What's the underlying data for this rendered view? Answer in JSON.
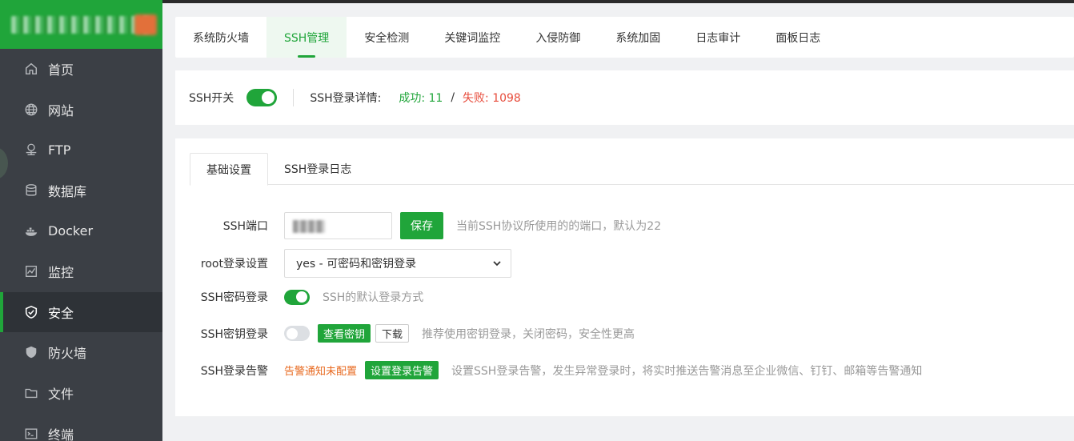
{
  "sidebar": {
    "items": [
      {
        "label": "首页",
        "icon": "home-icon"
      },
      {
        "label": "网站",
        "icon": "globe-icon"
      },
      {
        "label": "FTP",
        "icon": "ftp-icon"
      },
      {
        "label": "数据库",
        "icon": "database-icon"
      },
      {
        "label": "Docker",
        "icon": "docker-icon"
      },
      {
        "label": "监控",
        "icon": "monitor-icon"
      },
      {
        "label": "安全",
        "icon": "shield-check-icon",
        "active": true
      },
      {
        "label": "防火墙",
        "icon": "firewall-shield-icon"
      },
      {
        "label": "文件",
        "icon": "folder-icon"
      },
      {
        "label": "终端",
        "icon": "terminal-icon"
      }
    ]
  },
  "tabs": [
    "系统防火墙",
    "SSH管理",
    "安全检测",
    "关键词监控",
    "入侵防御",
    "系统加固",
    "日志审计",
    "面板日志"
  ],
  "active_tab": "SSH管理",
  "status": {
    "switch_label": "SSH开关",
    "details_label": "SSH登录详情:",
    "success": "成功: 11",
    "separator": "/",
    "fail": "失败: 1098"
  },
  "subtabs": [
    "基础设置",
    "SSH登录日志"
  ],
  "settings": {
    "port_label": "SSH端口",
    "save_label": "保存",
    "port_hint": "当前SSH协议所使用的的端口，默认为22",
    "root_label": "root登录设置",
    "root_value": "yes - 可密码和密钥登录",
    "password_label": "SSH密码登录",
    "password_hint": "SSH的默认登录方式",
    "key_label": "SSH密钥登录",
    "view_key_label": "查看密钥",
    "download_label": "下载",
    "key_hint": "推荐使用密钥登录，关闭密码，安全性更高",
    "alarm_label": "SSH登录告警",
    "alarm_status": "告警通知未配置",
    "alarm_button": "设置登录告警",
    "alarm_hint": "设置SSH登录告警，发生异常登录时，将实时推送告警消息至企业微信、钉钉、邮箱等告警通知"
  },
  "colors": {
    "accent": "#20a53a",
    "sidebar": "#3b3f45",
    "fail": "#e74c3c",
    "warn": "#e8691f"
  }
}
